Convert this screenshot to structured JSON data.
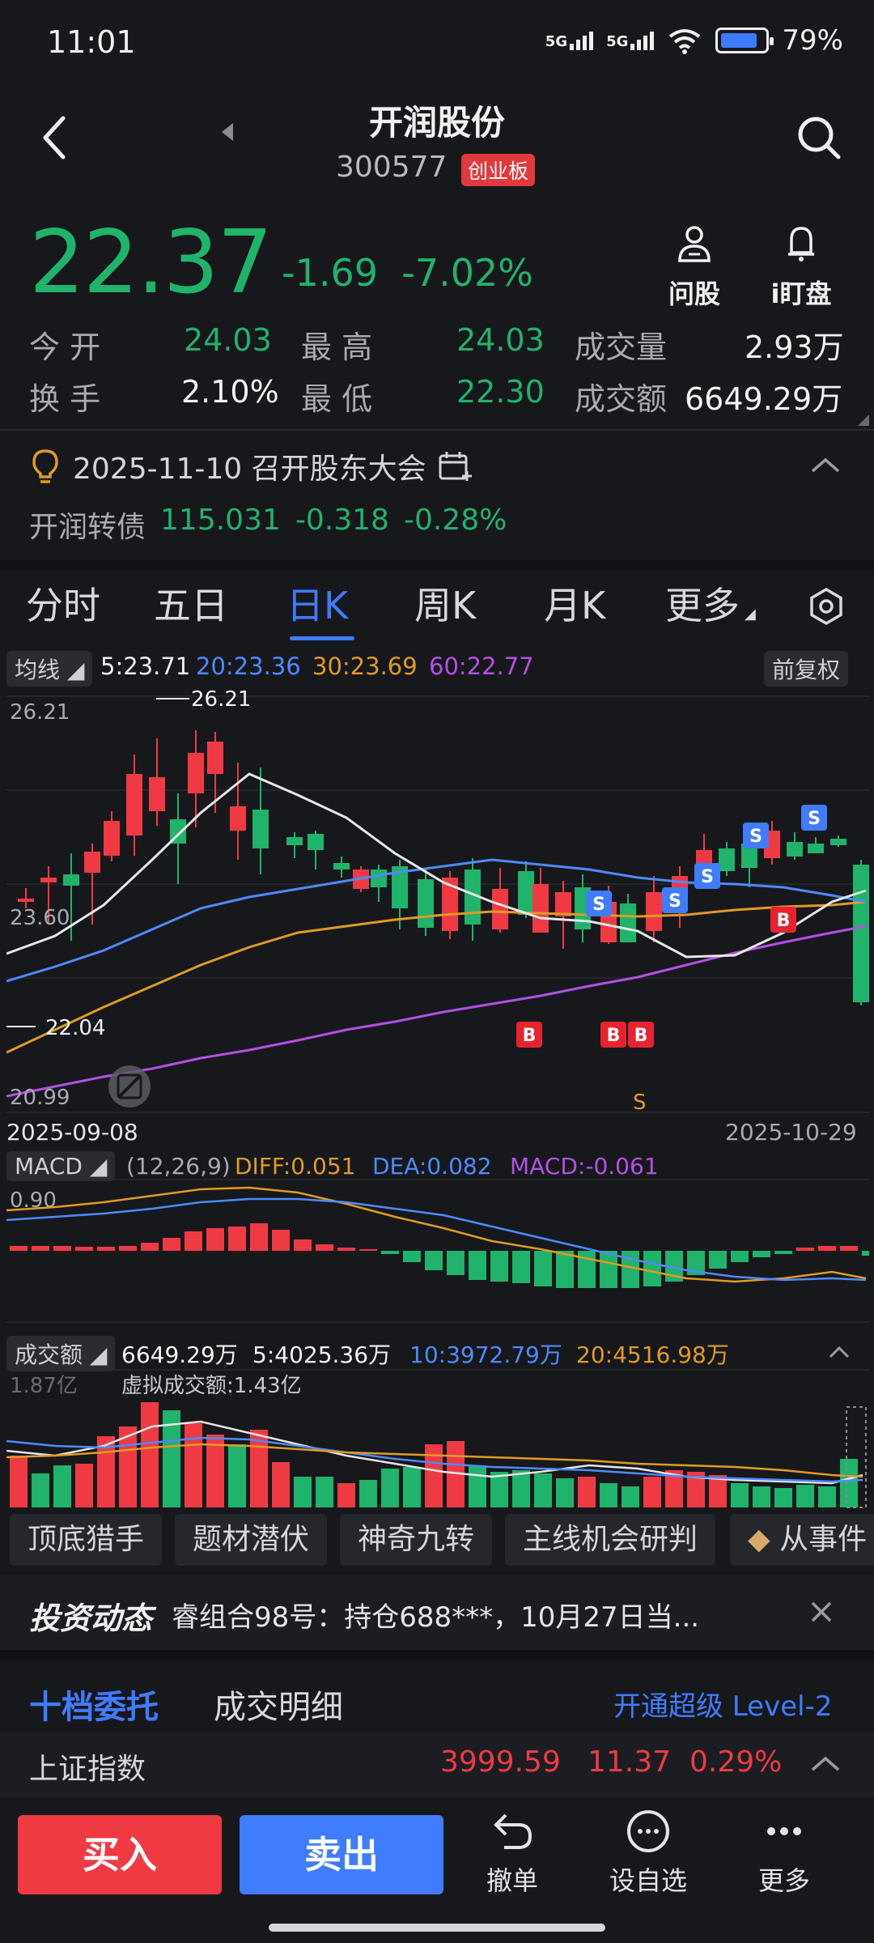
{
  "status": {
    "time": "11:01",
    "net1": "5G",
    "net2": "5G",
    "battery": "79%"
  },
  "header": {
    "title": "开润股份",
    "code": "300577",
    "board": "创业板"
  },
  "quote": {
    "price": "22.37",
    "change": "-1.69",
    "change_pct": "-7.02%",
    "ask_stock": "问股",
    "watch": "i盯盘",
    "open_label": "今  开",
    "open": "24.03",
    "high_label": "最  高",
    "high": "24.03",
    "vol_label": "成交量",
    "vol": "2.93万",
    "turnover_label": "换  手",
    "turnover": "2.10%",
    "low_label": "最  低",
    "low": "22.30",
    "amount_label": "成交额",
    "amount": "6649.29万"
  },
  "notice": {
    "text": "2025-11-10 召开股东大会"
  },
  "bond": {
    "name": "开润转债",
    "price": "115.031",
    "change": "-0.318",
    "pct": "-0.28%"
  },
  "tabs": [
    "分时",
    "五日",
    "日K",
    "周K",
    "月K",
    "更多"
  ],
  "ma": {
    "label": "均线",
    "ma5": "5:23.71",
    "ma20": "20:23.36",
    "ma30": "30:23.69",
    "ma60": "60:22.77",
    "adjust": "前复权"
  },
  "kchart": {
    "y_max": "26.21",
    "y_mid": "23.60",
    "y_min": "20.99",
    "peak_label": "26.21",
    "low_marker": "22.04",
    "date_start": "2025-09-08",
    "date_end": "2025-10-29",
    "s_text": "S",
    "b_text": "B"
  },
  "macd": {
    "label": "MACD",
    "params": "(12,26,9)",
    "diff": "DIFF:0.051",
    "dea": "DEA:0.082",
    "macd": "MACD:-0.061",
    "top": "0.90"
  },
  "volume": {
    "label": "成交额",
    "total": "6649.29万",
    "ma5": "5:4025.36万",
    "ma10": "10:3972.79万",
    "ma20": "20:4516.98万",
    "top": "1.87亿",
    "virtual": "虚拟成交额:1.43亿"
  },
  "tools": [
    "顶底猎手",
    "题材潜伏",
    "神奇九转",
    "主线机会研判",
    "从事件"
  ],
  "news": {
    "brand": "投资动态",
    "text": "睿组合98号：持仓688***，10月27日当..."
  },
  "order_tabs": {
    "tab1": "十档委托",
    "tab2": "成交明细",
    "level2": "开通超级 Level-2"
  },
  "index": {
    "name": "上证指数",
    "value": "3999.59",
    "change": "11.37",
    "pct": "0.29%"
  },
  "actions": {
    "buy": "买入",
    "sell": "卖出",
    "cancel": "撤单",
    "watchlist": "设自选",
    "more": "更多"
  },
  "colors": {
    "up": "#ef3a44",
    "down": "#1fb36b",
    "accent": "#3f7cff",
    "ma5": "#e8e8e8",
    "ma10": "#4d8bff",
    "ma20": "#e09b22",
    "ma60": "#b54fe6"
  }
}
